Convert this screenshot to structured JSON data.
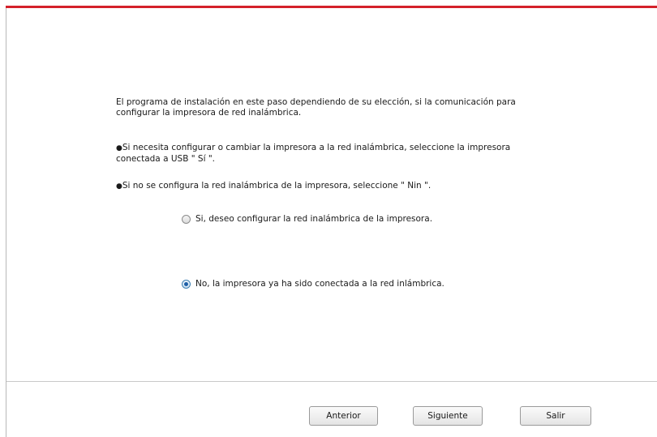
{
  "instructions": {
    "intro": "El programa de instalación en este paso dependiendo de su elección, si la comunicación para configurar la impresora de red inalámbrica.",
    "bullet_marker": "●",
    "bullet_yes": "Si necesita configurar o cambiar la impresora a la red inalámbrica, seleccione la impresora conectada a USB \" Sí \".",
    "bullet_no": "Si no se configura la red inalámbrica de la impresora, seleccione \" Nin \"."
  },
  "options": {
    "yes_label": "Si, deseo configurar la red inalámbrica de la impresora.",
    "no_label": "No, la impresora ya ha sido conectada a la red inlámbrica.",
    "selected": "no"
  },
  "buttons": {
    "back_label": "Anterior",
    "next_label": "Siguiente",
    "exit_label": "Salir"
  },
  "colors": {
    "accent": "#d4202a",
    "radio_selected": "#1e5fa6"
  }
}
